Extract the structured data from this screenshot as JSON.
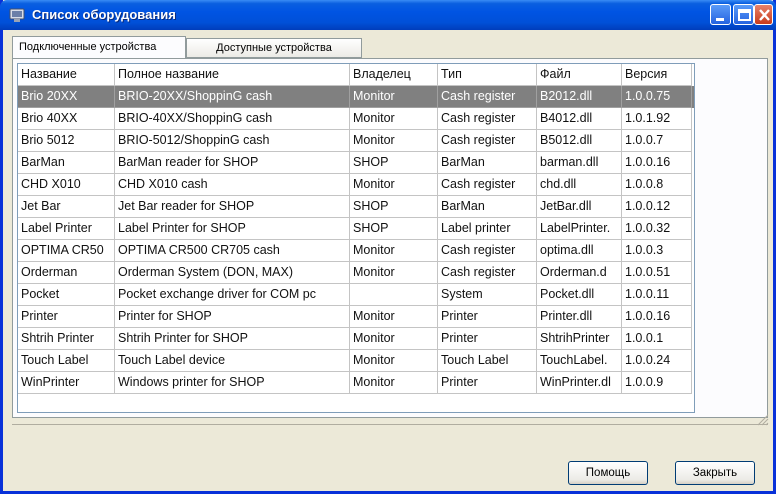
{
  "window": {
    "title": "Список оборудования",
    "colors": {
      "titlebar": "#0054e3",
      "selection": "#808080",
      "close": "#c73b1c"
    }
  },
  "tabs": [
    {
      "label": "Подключенные устройства",
      "active": true
    },
    {
      "label": "Доступные устройства",
      "active": false
    }
  ],
  "table": {
    "columns": [
      "Название",
      "Полное название",
      "Владелец",
      "Тип",
      "Файл",
      "Версия"
    ],
    "selected_row": 0,
    "rows": [
      [
        "Brio 20XX",
        "BRIO-20XX/ShoppinG cash",
        "Monitor",
        "Cash register",
        "B2012.dll",
        "1.0.0.75"
      ],
      [
        "Brio 40XX",
        "BRIO-40XX/ShoppinG cash",
        "Monitor",
        "Cash register",
        "B4012.dll",
        "1.0.1.92"
      ],
      [
        "Brio 5012",
        "BRIO-5012/ShoppinG cash",
        "Monitor",
        "Cash register",
        "B5012.dll",
        "1.0.0.7"
      ],
      [
        "BarMan",
        "BarMan reader for SHOP",
        "SHOP",
        "BarMan",
        "barman.dll",
        "1.0.0.16"
      ],
      [
        "CHD X010",
        "CHD X010 cash",
        "Monitor",
        "Cash register",
        "chd.dll",
        "1.0.0.8"
      ],
      [
        "Jet Bar",
        "Jet Bar reader for SHOP",
        "SHOP",
        "BarMan",
        "JetBar.dll",
        "1.0.0.12"
      ],
      [
        "Label Printer",
        "Label Printer for SHOP",
        "SHOP",
        "Label printer",
        "LabelPrinter.",
        "1.0.0.32"
      ],
      [
        "OPTIMA CR50",
        "OPTIMA CR500 CR705 cash",
        "Monitor",
        "Cash register",
        "optima.dll",
        "1.0.0.3"
      ],
      [
        "Orderman",
        "Orderman System (DON, MAX)",
        "Monitor",
        "Cash register",
        "Orderman.d",
        "1.0.0.51"
      ],
      [
        "Pocket",
        "Pocket exchange driver for COM pc",
        "",
        "System",
        "Pocket.dll",
        "1.0.0.11"
      ],
      [
        "Printer",
        "Printer for SHOP",
        "Monitor",
        "Printer",
        "Printer.dll",
        "1.0.0.16"
      ],
      [
        "Shtrih Printer",
        "Shtrih Printer for SHOP",
        "Monitor",
        "Printer",
        "ShtrihPrinter",
        "1.0.0.1"
      ],
      [
        "Touch Label",
        "Touch Label device",
        "Monitor",
        "Touch Label",
        "TouchLabel.",
        "1.0.0.24"
      ],
      [
        "WinPrinter",
        "Windows printer for SHOP",
        "Monitor",
        "Printer",
        "WinPrinter.dl",
        "1.0.0.9"
      ]
    ]
  },
  "buttons": {
    "help": "Помощь",
    "close": "Закрыть"
  }
}
